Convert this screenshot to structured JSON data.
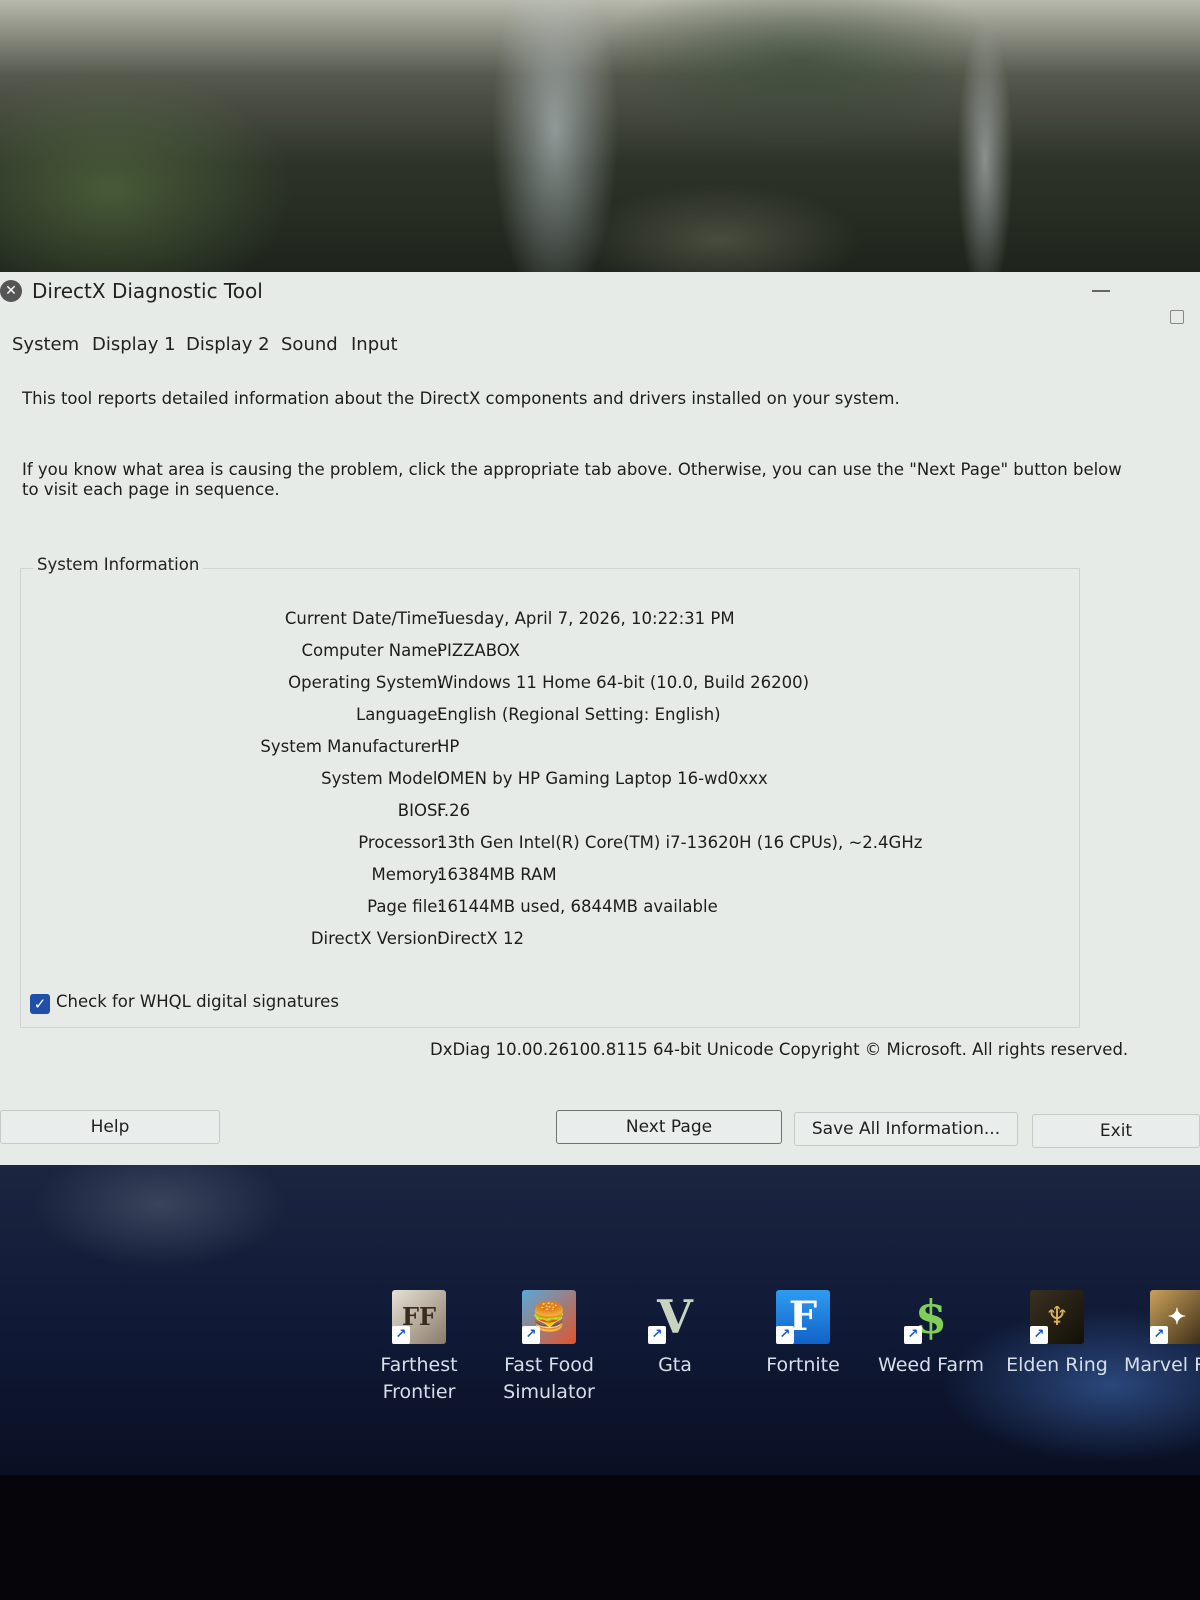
{
  "window": {
    "title": "DirectX Diagnostic Tool",
    "icon": "directx-icon"
  },
  "tabs": [
    {
      "label": "System",
      "selected": true
    },
    {
      "label": "Display 1"
    },
    {
      "label": "Display 2"
    },
    {
      "label": "Sound"
    },
    {
      "label": "Input"
    }
  ],
  "intro": {
    "line1": "This tool reports detailed information about the DirectX components and drivers installed on your system.",
    "line2": "If you know what area is causing the problem, click the appropriate tab above.  Otherwise, you can use the \"Next Page\" button below to visit each page in sequence."
  },
  "system_info": {
    "group_label": "System Information",
    "rows": [
      {
        "label": "Current Date/Time:",
        "value": "Tuesday, April 7, 2026, 10:22:31 PM"
      },
      {
        "label": "Computer Name:",
        "value": "PIZZABOX"
      },
      {
        "label": "Operating System:",
        "value": "Windows 11 Home 64-bit (10.0, Build 26200)"
      },
      {
        "label": "Language:",
        "value": "English (Regional Setting: English)"
      },
      {
        "label": "System Manufacturer:",
        "value": "HP"
      },
      {
        "label": "System Model:",
        "value": "OMEN by HP Gaming Laptop 16-wd0xxx"
      },
      {
        "label": "BIOS:",
        "value": "F.26"
      },
      {
        "label": "Processor:",
        "value": "13th Gen Intel(R) Core(TM) i7-13620H (16 CPUs), ~2.4GHz"
      },
      {
        "label": "Memory:",
        "value": "16384MB RAM"
      },
      {
        "label": "Page file:",
        "value": "16144MB used, 6844MB available"
      },
      {
        "label": "DirectX Version:",
        "value": "DirectX 12"
      }
    ]
  },
  "whql": {
    "label": "Check for WHQL digital signatures",
    "checked": true
  },
  "footer": {
    "text": "DxDiag 10.00.26100.8115 64-bit Unicode  Copyright © Microsoft. All rights reserved."
  },
  "buttons": {
    "help": "Help",
    "next_page": "Next Page",
    "save_all": "Save All Information...",
    "exit": "Exit"
  },
  "desktop_icons": [
    {
      "name": "Farthest Frontier",
      "line1": "Farthest",
      "line2": "Frontier",
      "glyph": "FF"
    },
    {
      "name": "Fast Food Simulator",
      "line1": "Fast Food",
      "line2": "Simulator",
      "glyph": "🍔"
    },
    {
      "name": "Gta",
      "line1": "Gta",
      "line2": "",
      "glyph": "V"
    },
    {
      "name": "Fortnite",
      "line1": "Fortnite",
      "line2": "",
      "glyph": "F"
    },
    {
      "name": "Weed Farm",
      "line1": "Weed Farm",
      "line2": "",
      "glyph": "$"
    },
    {
      "name": "Elden Ring",
      "line1": "Elden Ring",
      "line2": "",
      "glyph": "♆"
    },
    {
      "name": "Marvel R",
      "line1": "Marvel R",
      "line2": "",
      "glyph": "✦"
    }
  ],
  "shortcut_arrow": "↗"
}
